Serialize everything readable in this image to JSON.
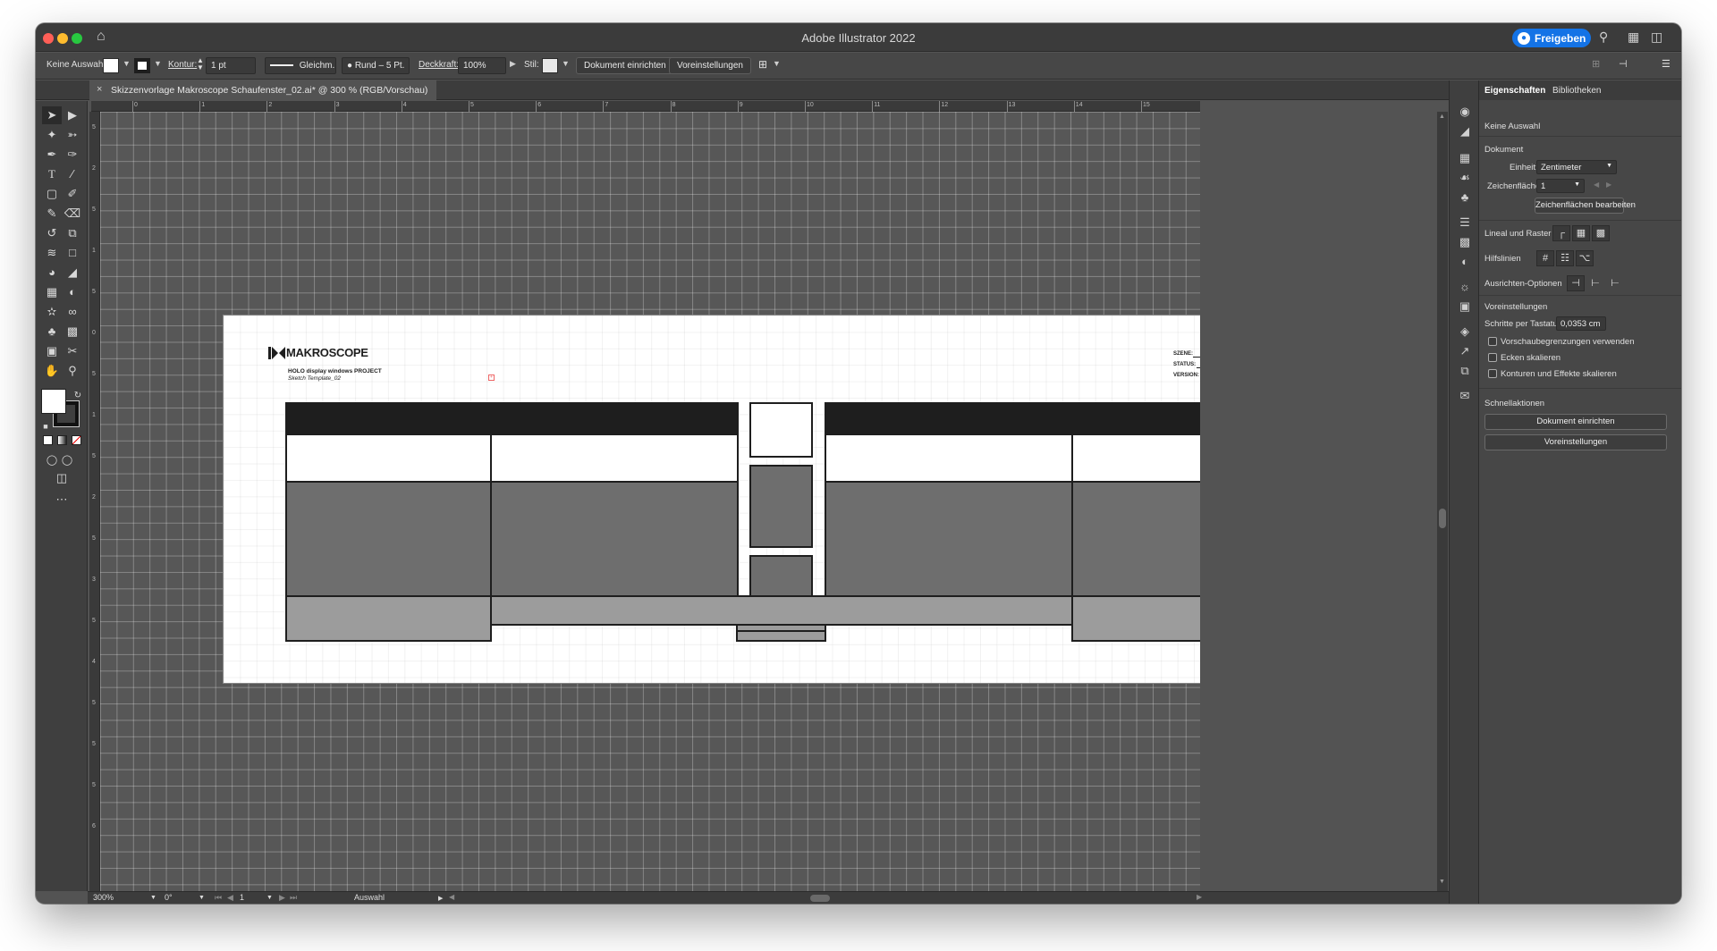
{
  "window": {
    "title": "Adobe Illustrator 2022",
    "share_label": "Freigeben"
  },
  "controlbar": {
    "selection": "Keine Auswahl",
    "stroke_label": "Kontur:",
    "stroke_weight": "1 pt",
    "stroke_profile": "Gleichm.",
    "brush": "Rund – 5 Pt.",
    "opacity_label": "Deckkraft:",
    "opacity_value": "100%",
    "style_label": "Stil:",
    "doc_setup_button": "Dokument einrichten",
    "prefs_button": "Voreinstellungen"
  },
  "document": {
    "tab_title": "Skizzenvorlage Makroscope Schaufenster_02.ai* @ 300 % (RGB/Vorschau)"
  },
  "rulers": {
    "top": [
      "0",
      "1",
      "2",
      "3",
      "4",
      "5",
      "6",
      "7",
      "8",
      "9",
      "10",
      "11",
      "12",
      "13",
      "14",
      "15"
    ],
    "left": [
      "5",
      "2",
      "5",
      "1",
      "5",
      "0",
      "5",
      "1",
      "5",
      "2",
      "5",
      "3",
      "5",
      "4",
      "5",
      "5",
      "5",
      "6"
    ]
  },
  "artboard": {
    "logo_text": "MAKROSCOPE",
    "project_title": "HOLO display windows PROJECT",
    "project_subtitle": "Sketch Template_02",
    "fields": [
      "SZENE:",
      "STATUS:",
      "VERSION:"
    ]
  },
  "statusbar": {
    "zoom": "300%",
    "rotation": "0°",
    "artboard_index": "1",
    "tool": "Auswahl"
  },
  "properties": {
    "tabs": [
      "Eigenschaften",
      "Bibliotheken"
    ],
    "selection": "Keine Auswahl",
    "section_document": "Dokument",
    "unit_label": "Einheit:",
    "unit_value": "Zentimeter",
    "artboard_label": "Zeichenfläche:",
    "artboard_value": "1",
    "edit_artboards_button": "Zeichenflächen bearbeiten",
    "rulers_grid_label": "Lineal und Raster",
    "guides_label": "Hilfslinien",
    "align_options_label": "Ausrichten-Optionen",
    "section_prefs": "Voreinstellungen",
    "keyboard_increment_label": "Schritte per Tastatur:",
    "keyboard_increment_value": "0,0353 cm",
    "checkboxes": [
      "Vorschaubegrenzungen verwenden",
      "Ecken skalieren",
      "Konturen und Effekte skalieren"
    ],
    "section_quick": "Schnellaktionen",
    "quick_doc_setup": "Dokument einrichten",
    "quick_prefs": "Voreinstellungen"
  },
  "colors": {
    "share_blue": "#1473e6",
    "ui_dark": "#535353",
    "artboard_dark": "#1e1e1e",
    "artboard_mid": "#6e6e6e",
    "artboard_light": "#9c9c9c"
  }
}
